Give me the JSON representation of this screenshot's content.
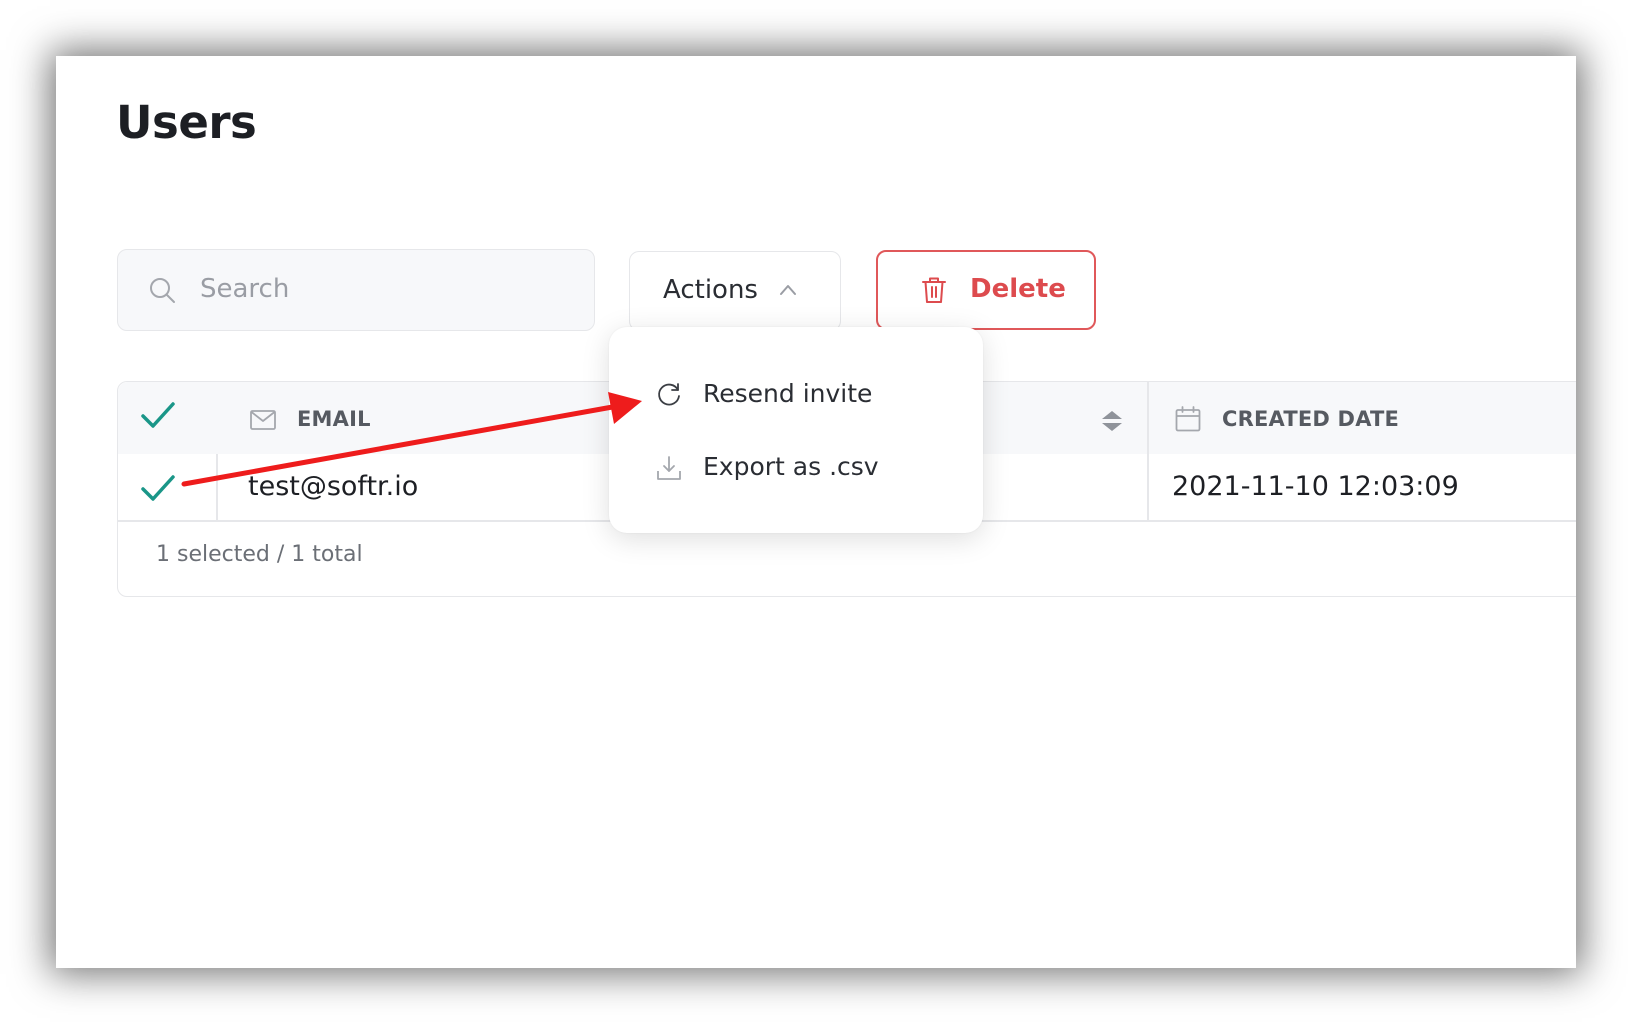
{
  "page": {
    "title": "Users"
  },
  "toolbar": {
    "search_placeholder": "Search",
    "actions_label": "Actions",
    "delete_label": "Delete"
  },
  "actions_menu": {
    "items": [
      {
        "label": "Resend invite",
        "icon": "refresh-icon"
      },
      {
        "label": "Export as .csv",
        "icon": "download-icon"
      }
    ]
  },
  "table": {
    "columns": [
      {
        "label": "EMAIL",
        "icon": "mail-icon"
      },
      {
        "label": "CREATED DATE",
        "icon": "calendar-icon"
      }
    ],
    "rows": [
      {
        "email": "test@softr.io",
        "created_date": "2021-11-10 12:03:09",
        "selected": true
      }
    ],
    "footer": "1 selected / 1 total"
  },
  "colors": {
    "accent_check": "#1a9688",
    "delete": "#dd4b4e",
    "annotation_arrow": "#ee1c1c"
  }
}
